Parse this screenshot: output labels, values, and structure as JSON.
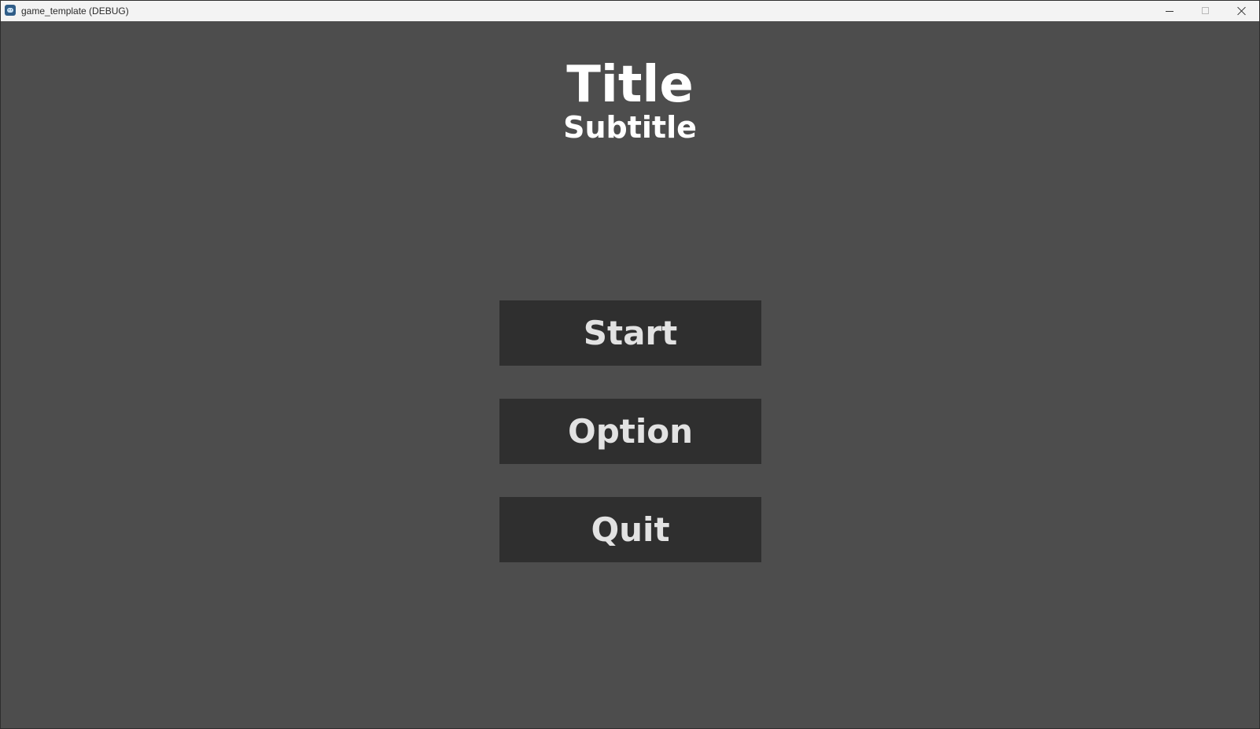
{
  "window": {
    "title": "game_template (DEBUG)",
    "icon": "godot-engine-icon"
  },
  "screen": {
    "title": "Title",
    "subtitle": "Subtitle"
  },
  "menu": {
    "start_label": "Start",
    "option_label": "Option",
    "quit_label": "Quit"
  },
  "colors": {
    "background": "#4d4d4d",
    "button": "#2f2f2f",
    "button_text": "#e2e2e2",
    "title_text": "#ffffff"
  }
}
